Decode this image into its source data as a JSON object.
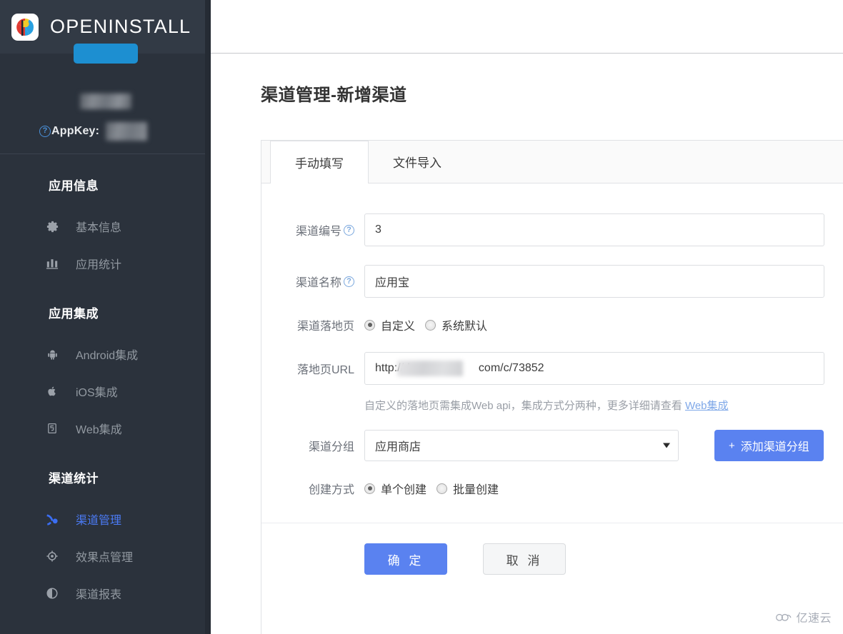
{
  "brand": {
    "name": "OPENINSTALL",
    "logo_icon": "openinstall-logo-icon"
  },
  "sidebar": {
    "appkey_label": "AppKey:",
    "help_icon": "question-mark-icon",
    "sections": [
      {
        "title": "应用信息",
        "items": [
          {
            "label": "基本信息",
            "icon": "gear-icon",
            "active": false
          },
          {
            "label": "应用统计",
            "icon": "bar-chart-icon",
            "active": false
          }
        ]
      },
      {
        "title": "应用集成",
        "items": [
          {
            "label": "Android集成",
            "icon": "android-icon",
            "active": false
          },
          {
            "label": "iOS集成",
            "icon": "apple-icon",
            "active": false
          },
          {
            "label": "Web集成",
            "icon": "html5-icon",
            "active": false
          }
        ]
      },
      {
        "title": "渠道统计",
        "items": [
          {
            "label": "渠道管理",
            "icon": "channel-icon",
            "active": true
          },
          {
            "label": "效果点管理",
            "icon": "target-icon",
            "active": false
          },
          {
            "label": "渠道报表",
            "icon": "contrast-circle-icon",
            "active": false
          }
        ]
      }
    ]
  },
  "page": {
    "title": "渠道管理-新增渠道"
  },
  "tabs": [
    {
      "label": "手动填写",
      "active": true
    },
    {
      "label": "文件导入",
      "active": false
    }
  ],
  "form": {
    "channel_no": {
      "label": "渠道编号",
      "help_icon": "question-mark-icon",
      "value": "3"
    },
    "channel_name": {
      "label": "渠道名称",
      "help_icon": "question-mark-icon",
      "value": "应用宝"
    },
    "landing_page": {
      "label": "渠道落地页",
      "options": [
        {
          "label": "自定义",
          "checked": true
        },
        {
          "label": "系统默认",
          "checked": false
        }
      ]
    },
    "landing_url": {
      "label": "落地页URL",
      "value_prefix": "http://d",
      "value_suffix": "com/c/73852",
      "hint_text": "自定义的落地页需集成Web api，集成方式分两种，更多详细请查看 ",
      "hint_link": "Web集成"
    },
    "channel_group": {
      "label": "渠道分组",
      "selected": "应用商店",
      "caret_icon": "chevron-down-icon",
      "add_button": "添加渠道分组",
      "add_button_plus": "+"
    },
    "create_mode": {
      "label": "创建方式",
      "options": [
        {
          "label": "单个创建",
          "checked": true
        },
        {
          "label": "批量创建",
          "checked": false
        }
      ]
    }
  },
  "actions": {
    "confirm": "确 定",
    "cancel": "取 消"
  },
  "watermark": {
    "icon": "cloud-icon",
    "text": "亿速云"
  },
  "colors": {
    "sidebar_bg": "#2b323c",
    "sidebar_header_bg": "#323a45",
    "accent_blue": "#5a82f0",
    "active_nav": "#4b7bf5",
    "pill_blue": "#1d8fd1"
  }
}
